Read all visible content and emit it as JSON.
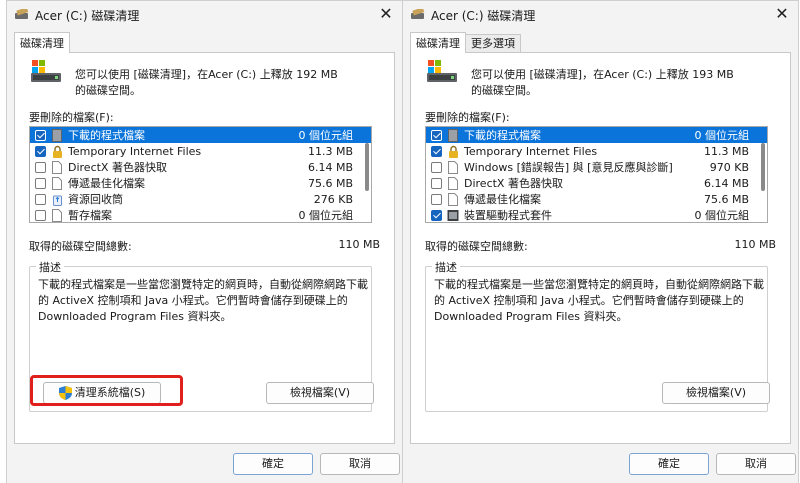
{
  "left": {
    "title": "Acer (C:) 磁碟清理",
    "tabs": [
      {
        "label": "磁碟清理"
      }
    ],
    "intro": "您可以使用 [磁碟清理]，在Acer (C:) 上釋放 192 MB 的磁碟空間。",
    "list_label": "要刪除的檔案(F):",
    "files": [
      {
        "name": "下載的程式檔案",
        "size": "0 個位元組",
        "checked": true,
        "selected": true,
        "icon": "folder-icon"
      },
      {
        "name": "Temporary Internet Files",
        "size": "11.3 MB",
        "checked": true,
        "selected": false,
        "icon": "lock-icon"
      },
      {
        "name": "DirectX 著色器快取",
        "size": "6.14 MB",
        "checked": false,
        "selected": false,
        "icon": "file-icon"
      },
      {
        "name": "傳遞最佳化檔案",
        "size": "75.6 MB",
        "checked": false,
        "selected": false,
        "icon": "file-icon"
      },
      {
        "name": "資源回收筒",
        "size": "276 KB",
        "checked": false,
        "selected": false,
        "icon": "recycle-bin-icon"
      },
      {
        "name": "暫存檔案",
        "size": "0 個位元組",
        "checked": false,
        "selected": false,
        "icon": "file-icon"
      }
    ],
    "total_label": "取得的磁碟空間總數:",
    "total_value": "110 MB",
    "group_title": "描述",
    "description": "下載的程式檔案是一些當您瀏覽特定的網頁時，自動從網際網路下載的 ActiveX 控制項和 Java 小程式。它們暫時會儲存到硬碟上的 Downloaded Program Files 資料夾。",
    "clean_button": "清理系統檔(S)",
    "view_button": "檢視檔案(V)",
    "ok_button": "確定",
    "cancel_button": "取消"
  },
  "right": {
    "title": "Acer (C:) 磁碟清理",
    "tabs": [
      {
        "label": "磁碟清理"
      },
      {
        "label": "更多選項"
      }
    ],
    "intro": "您可以使用 [磁碟清理]，在Acer (C:) 上釋放 193 MB 的磁碟空間。",
    "list_label": "要刪除的檔案(F):",
    "files": [
      {
        "name": "下載的程式檔案",
        "size": "0 個位元組",
        "checked": true,
        "selected": true,
        "icon": "folder-icon"
      },
      {
        "name": "Temporary Internet Files",
        "size": "11.3 MB",
        "checked": true,
        "selected": false,
        "icon": "lock-icon"
      },
      {
        "name": "Windows [錯誤報告] 與 [意見反應與診斷]",
        "size": "970 KB",
        "checked": false,
        "selected": false,
        "icon": "file-icon"
      },
      {
        "name": "DirectX 著色器快取",
        "size": "6.14 MB",
        "checked": false,
        "selected": false,
        "icon": "file-icon"
      },
      {
        "name": "傳遞最佳化檔案",
        "size": "75.6 MB",
        "checked": false,
        "selected": false,
        "icon": "file-icon"
      },
      {
        "name": "裝置驅動程式套件",
        "size": "0 個位元組",
        "checked": true,
        "selected": false,
        "icon": "device-icon"
      }
    ],
    "total_label": "取得的磁碟空間總數:",
    "total_value": "110 MB",
    "group_title": "描述",
    "description": "下載的程式檔案是一些當您瀏覽特定的網頁時，自動從網際網路下載的 ActiveX 控制項和 Java 小程式。它們暫時會儲存到硬碟上的 Downloaded Program Files 資料夾。",
    "view_button": "檢視檔案(V)",
    "ok_button": "確定",
    "cancel_button": "取消"
  },
  "colors": {
    "selection": "#0a74da",
    "highlight": "#e0201c",
    "checkbox": "#1565c0"
  }
}
